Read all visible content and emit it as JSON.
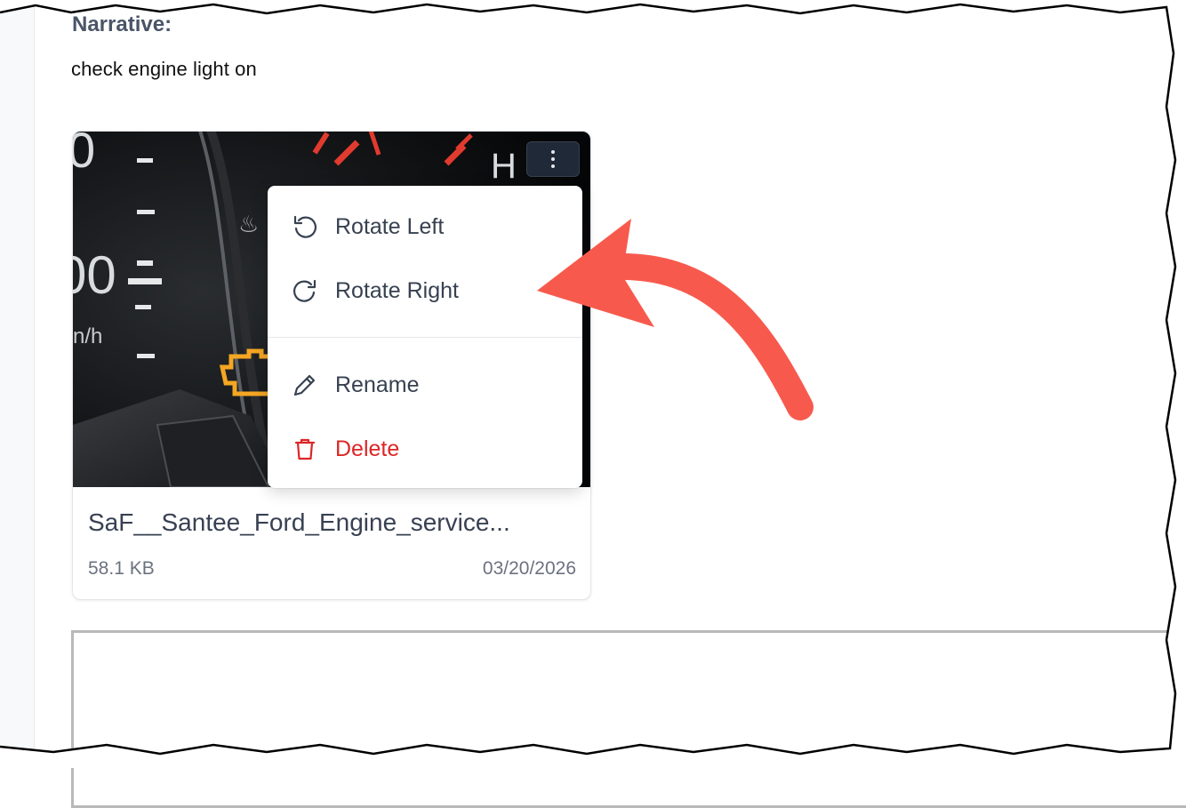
{
  "narrative": {
    "label": "Narrative:",
    "text": "check engine light on"
  },
  "attachment": {
    "file_name": "SaF__Santee_Ford_Engine_service...",
    "file_size": "58.1 KB",
    "date": "03/20/2026",
    "image_subject": "dashboard-check-engine-light",
    "menu_button_icon": "more-vertical-icon"
  },
  "context_menu": {
    "items": [
      {
        "label": "Rotate Left",
        "icon": "rotate-left-icon"
      },
      {
        "label": "Rotate Right",
        "icon": "rotate-right-icon"
      },
      {
        "label": "Rename",
        "icon": "pencil-icon"
      },
      {
        "label": "Delete",
        "icon": "trash-icon",
        "danger": true
      }
    ]
  },
  "annotation": {
    "type": "callout-arrow",
    "color": "#f75a4d",
    "points_to": "Rotate Right"
  },
  "colors": {
    "text_default": "#374151",
    "danger": "#dc2626",
    "muted": "#6b7280",
    "engine_light": "#f5a623"
  }
}
